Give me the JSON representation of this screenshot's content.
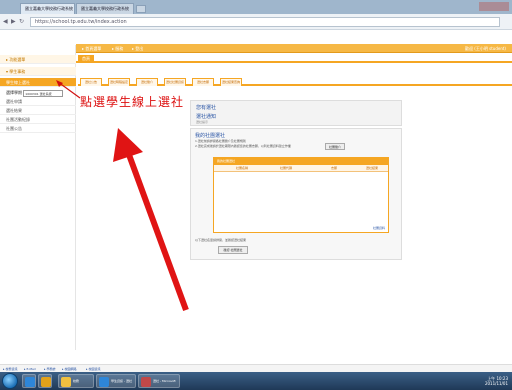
{
  "browser": {
    "tabs": [
      {
        "label": "國立嘉義大學校務行政系統"
      },
      {
        "label": "國立嘉義大學校務行政系統"
      }
    ],
    "url": "https://school.tp.edu.tw/index.action"
  },
  "sidebar": {
    "items": [
      {
        "label": "▸ 功能選單"
      },
      {
        "label": "▾ 學生事務"
      },
      {
        "label": "學生線上選社"
      },
      {
        "label": "選社申請"
      },
      {
        "label": "選社結果"
      },
      {
        "label": "社團活動紀錄"
      },
      {
        "label": "社團公告"
      }
    ],
    "select_prefix": "選擇學期",
    "select_value": "1000301 選社系統"
  },
  "topbar": {
    "items": [
      {
        "label": "▸ 首頁選單"
      },
      {
        "label": "▸ 服務"
      },
      {
        "label": "▸ 登出"
      }
    ],
    "user": "歡迎 (王小明 student)"
  },
  "subbar": {
    "tab": "首頁"
  },
  "content_tabs": [
    {
      "label": "選社公告"
    },
    {
      "label": "選社時程設定"
    },
    {
      "label": "選社簡介"
    },
    {
      "label": "選社社團資訊"
    },
    {
      "label": "選社志願"
    },
    {
      "label": "選社結果查詢"
    }
  ],
  "panel1": {
    "title": "您有選社",
    "subtitle": "選社通知",
    "note": "選社提示"
  },
  "panel2": {
    "title": "我的社團選社",
    "line1": "1.選社前請詳閱各社團簡介及社團規則",
    "line2": "2.選社完成後請於選社期限內確認您的社團志願，以利社團資料建立作業",
    "button": "社團簡介",
    "grid": {
      "header": "我的社團選社",
      "columns": [
        "社團名稱",
        "社團代碼",
        "志願",
        "選社結果"
      ],
      "footer": "社團資料"
    },
    "line3": "以下選社名單請詳閱，並確認選社結果",
    "button2": "確認 社團選社"
  },
  "annotation": "點選學生線上選社",
  "bottom_links": [
    {
      "label": "▸ 校務資訊"
    },
    {
      "label": "▸ E-Mail"
    },
    {
      "label": "▸ 學務處"
    },
    {
      "label": "▸ 校園網路"
    },
    {
      "label": "▸ 校園資訊"
    }
  ],
  "taskbar": {
    "buttons": [
      {
        "label": "校務"
      },
      {
        "label": "學生資訊 - 選社"
      },
      {
        "label": "選社 - Microsoft"
      }
    ],
    "time": "上午 10:23",
    "date": "2011/11/01"
  },
  "colors": {
    "accent": "#f5a623",
    "annotation": "#d11111",
    "link": "#2a55a5"
  }
}
